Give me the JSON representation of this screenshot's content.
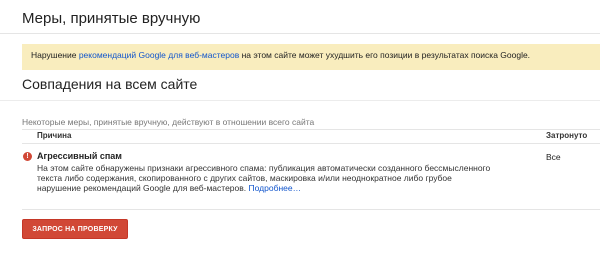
{
  "page": {
    "title": "Меры, принятые вручную"
  },
  "notice": {
    "prefix": "Нарушение ",
    "link": "рекомендаций Google для веб-мастеров",
    "suffix": " на этом сайте может ухудшить его позиции в результатах поиска Google."
  },
  "section": {
    "title": "Совпадения на всем сайте",
    "scope_text": "Некоторые меры, принятые вручную, действуют в отношении всего сайта"
  },
  "table": {
    "headers": {
      "reason": "Причина",
      "affected": "Затронуто"
    },
    "rows": [
      {
        "icon": "alert-icon",
        "icon_glyph": "!",
        "title": "Агрессивный спам",
        "desc_line1": "На этом сайте обнаружены признаки агрессивного спама: публикация автоматически созданного бессмысленного",
        "desc_line2": "текста либо содержания, скопированного с других сайтов, маскировка и/или неоднократное либо грубое",
        "desc_line3": "нарушение рекомендаций Google для веб-мастеров.",
        "more_link": "Подробнее…",
        "affected": "Все"
      }
    ]
  },
  "actions": {
    "review_button": "ЗАПРОС НА ПРОВЕРКУ"
  },
  "colors": {
    "notice_bg": "#f9edbe",
    "link": "#1155cc",
    "button_red": "#d14836",
    "alert_red": "#d14836"
  }
}
